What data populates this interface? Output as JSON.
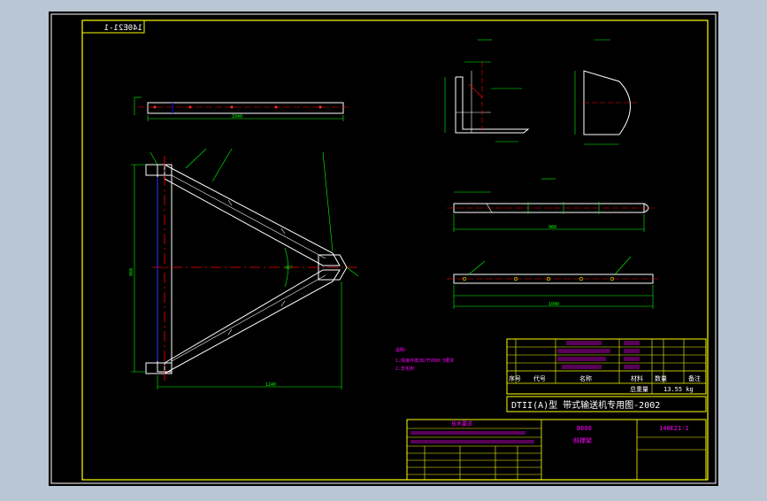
{
  "drawing": {
    "number_mirrored": "140E21-1",
    "number": "140E21-1",
    "title_block_main": "DTII(A)型 带式输送机专用图-2002",
    "spec": "B600",
    "part_name": "斜撑架",
    "weight": "13.55 kg",
    "label_weight_field": "总重量",
    "label_material": "材料",
    "label_quantity": "数量",
    "label_remarks": "备注",
    "label_seq": "序号",
    "label_name": "名称",
    "label_code": "代号",
    "label_doc_header": "技术要求",
    "note_title": "说明:",
    "note_line1": "1.焊接件按JB/T5000.3要求",
    "note_line2": "2.去毛刺"
  },
  "dims": {
    "top_bar_length": "1040",
    "frame_height": "960",
    "frame_base": "1240",
    "angle": "45°",
    "view_b_length": "960",
    "view_c_length": "1040"
  },
  "colors": {
    "background": "#000000",
    "frame": "#ffff00",
    "part": "#ffffff",
    "dimension": "#00ff00",
    "centerline": "#ff0000",
    "text": "#ff00ff"
  }
}
